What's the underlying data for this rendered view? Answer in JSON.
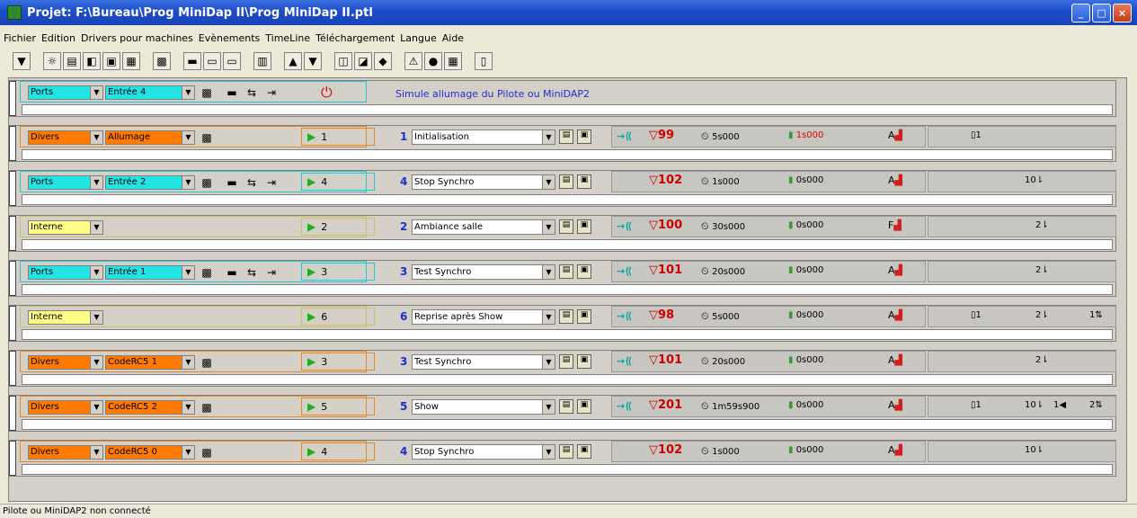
{
  "window": {
    "title": "Projet: F:\\Bureau\\Prog MiniDap II\\Prog MiniDap II.ptl"
  },
  "menu": [
    "Fichier",
    "Edition",
    "Drivers pour machines",
    "Evènements",
    "TimeLine",
    "Téléchargement",
    "Langue",
    "Aide"
  ],
  "status": "Pilote ou MiniDAP2 non connecté",
  "rows": [
    {
      "kind": "ports",
      "src": "Ports",
      "channel": "Entrée 4",
      "text": "Simule allumage du Pilote ou MiniDAP2"
    },
    {
      "kind": "divers",
      "src": "Divers",
      "channel": "Allumage",
      "trig": "1",
      "num": "1",
      "scene": "Initialisation",
      "tri": "99",
      "time": "5s000",
      "light": "1s000",
      "light_red": true,
      "mode": "A",
      "extra": [
        "1"
      ]
    },
    {
      "kind": "ports",
      "src": "Ports",
      "channel": "Entrée 2",
      "trig": "4",
      "num": "4",
      "scene": "Stop Synchro",
      "tri": "102",
      "time": "1s000",
      "light": "0s000",
      "mode": "A",
      "extra": [
        "10"
      ]
    },
    {
      "kind": "interne",
      "src": "Interne",
      "trig": "2",
      "num": "2",
      "scene": "Ambiance salle",
      "tri": "100",
      "time": "30s000",
      "light": "0s000",
      "mode": "F",
      "extra": [
        "2"
      ]
    },
    {
      "kind": "ports",
      "src": "Ports",
      "channel": "Entrée 1",
      "trig": "3",
      "num": "3",
      "scene": "Test Synchro",
      "tri": "101",
      "time": "20s000",
      "light": "0s000",
      "mode": "A",
      "extra": [
        "2"
      ]
    },
    {
      "kind": "interne",
      "src": "Interne",
      "trig": "6",
      "num": "6",
      "scene": "Reprise après  Show",
      "tri": "98",
      "time": "5s000",
      "light": "0s000",
      "mode": "A",
      "extra": [
        "1",
        "2",
        "1"
      ]
    },
    {
      "kind": "divers",
      "src": "Divers",
      "channel": "CodeRC5 1",
      "trig": "3",
      "num": "3",
      "scene": "Test Synchro",
      "tri": "101",
      "time": "20s000",
      "light": "0s000",
      "mode": "A",
      "extra": [
        "2"
      ]
    },
    {
      "kind": "divers",
      "src": "Divers",
      "channel": "CodeRC5 2",
      "trig": "5",
      "num": "5",
      "scene": "Show",
      "tri": "201",
      "time": "1m59s900",
      "light": "0s000",
      "mode": "A",
      "extra": [
        "1",
        "10",
        "1",
        "2"
      ]
    },
    {
      "kind": "divers",
      "src": "Divers",
      "channel": "CodeRC5 0",
      "trig": "4",
      "num": "4",
      "scene": "Stop Synchro",
      "tri": "102",
      "time": "1s000",
      "light": "0s000",
      "mode": "A",
      "extra": [
        "10"
      ]
    }
  ]
}
